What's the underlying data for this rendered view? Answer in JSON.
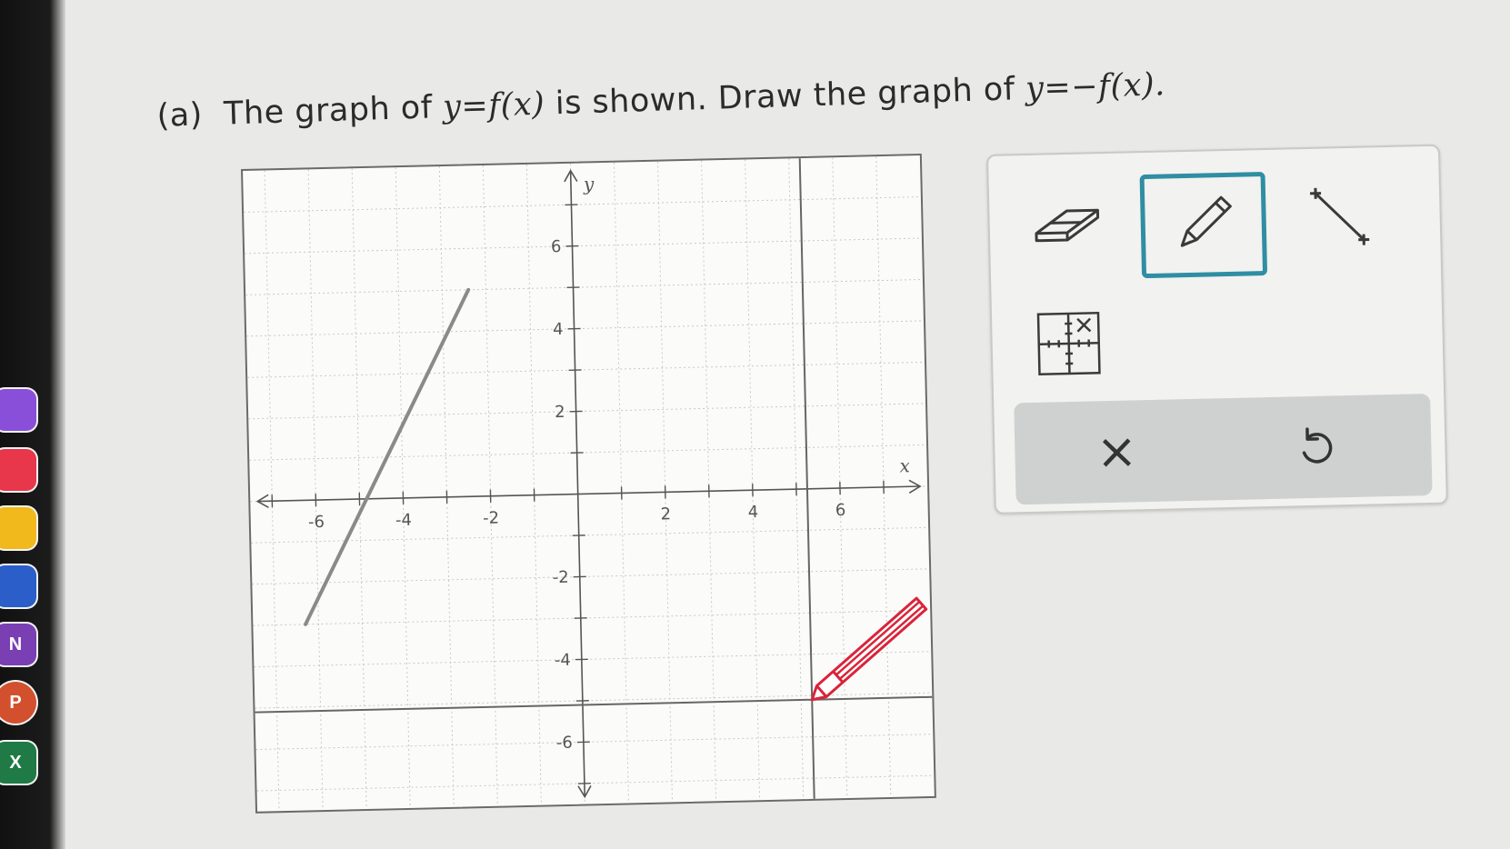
{
  "question": {
    "part": "(a)",
    "text_1": "The graph of",
    "expr_1": "y=f(x)",
    "text_2": "is shown. Draw the graph of",
    "expr_2": "y=−f(x)."
  },
  "graph": {
    "x_axis_label": "x",
    "y_axis_label": "y",
    "x_tick_labels": [
      "-6",
      "-4",
      "-2",
      "2",
      "4",
      "6"
    ],
    "y_tick_labels": [
      "6",
      "4",
      "2",
      "-2",
      "-4",
      "-6"
    ],
    "xlim": [
      -7.5,
      8
    ],
    "ylim": [
      -7.5,
      8
    ],
    "f_segment": {
      "x": [
        -6.3,
        -2.4
      ],
      "y": [
        -3,
        5
      ]
    },
    "line_color": "#8a8a8a",
    "grid_color": "#c8c8c8",
    "crosshair_color": "#666666",
    "pencil_cursor_color": "#d9243a"
  },
  "tools": {
    "eraser": "eraser-icon",
    "pencil": "pencil-icon",
    "line": "line-segment-icon",
    "coordinates": "coordinate-grid-icon",
    "selected_color": "#2f8ea3"
  },
  "actions": {
    "clear": "×",
    "undo": "undo-icon"
  },
  "dock": [
    {
      "icon": "photos-icon",
      "color": "#8a4fd8",
      "label": ""
    },
    {
      "icon": "news-icon",
      "color": "#e8364a",
      "label": ""
    },
    {
      "icon": "chrome-icon",
      "color": "#f2b91c",
      "label": ""
    },
    {
      "icon": "word-icon",
      "color": "#2b5ec9",
      "label": ""
    },
    {
      "icon": "onenote-icon",
      "color": "#7a3fb3",
      "label": "N"
    },
    {
      "icon": "powerpoint-icon",
      "color": "#d2502d",
      "label": "P"
    },
    {
      "icon": "excel-icon",
      "color": "#1f7a45",
      "label": "X"
    }
  ]
}
